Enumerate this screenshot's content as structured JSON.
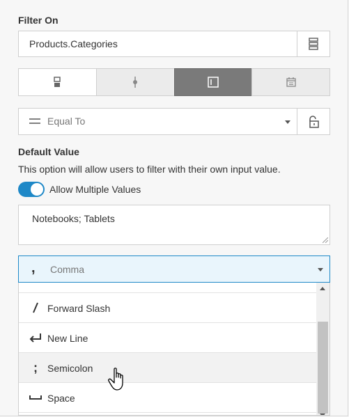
{
  "filter_on": {
    "heading": "Filter On",
    "field_value": "Products.Categories",
    "field_button_icon": "field-list-icon"
  },
  "filter_types": [
    {
      "icon": "list-filter-icon",
      "active": false
    },
    {
      "icon": "slider-filter-icon",
      "active": false
    },
    {
      "icon": "input-filter-icon",
      "active": true
    },
    {
      "icon": "calendar-icon",
      "active": false
    }
  ],
  "condition": {
    "icon": "equal-icon",
    "value": "Equal To",
    "lock_icon": "unlock-icon"
  },
  "default_value": {
    "heading": "Default Value",
    "description": "This option will allow users to filter with their own input value.",
    "allow_multiple_label": "Allow Multiple Values",
    "allow_multiple_on": true,
    "text": "Notebooks; Tablets"
  },
  "separator": {
    "selected_glyph": ",",
    "selected_label": "Comma",
    "options": [
      {
        "icon": "forward-slash-icon",
        "label": "Forward Slash"
      },
      {
        "icon": "new-line-icon",
        "label": "New Line"
      },
      {
        "icon": "semicolon-icon",
        "label": "Semicolon",
        "hovered": true
      },
      {
        "icon": "space-icon",
        "label": "Space"
      }
    ]
  },
  "colors": {
    "accent": "#1e88c7",
    "selected_bg": "#e9f5fc",
    "active_segment": "#7a7a7a"
  }
}
